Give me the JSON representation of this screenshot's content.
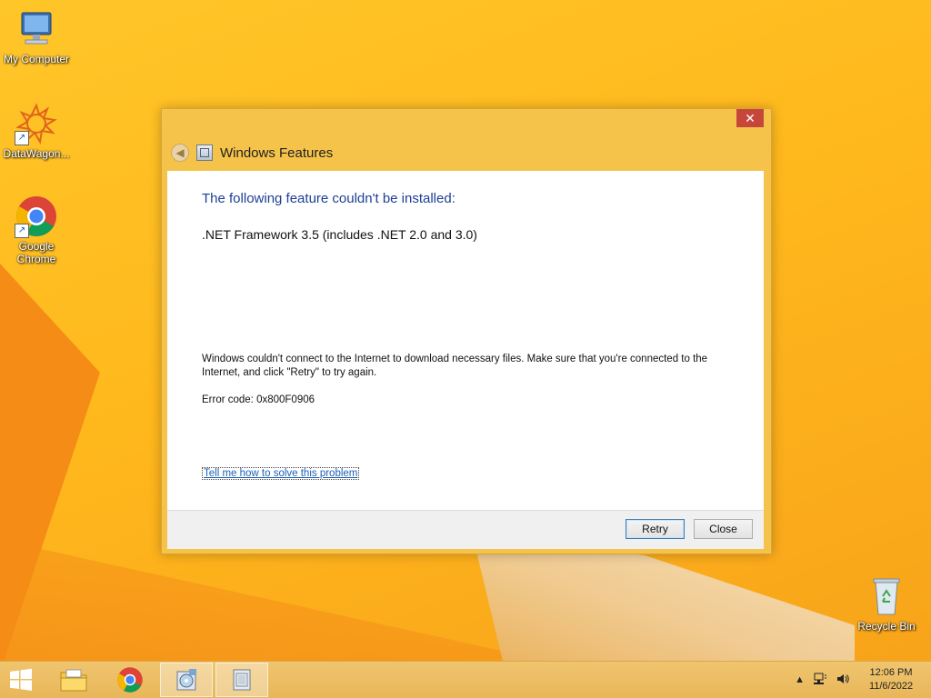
{
  "desktop": {
    "icons": [
      {
        "label": "My Computer"
      },
      {
        "label": "DataWagon..."
      },
      {
        "label": "Google Chrome"
      },
      {
        "label": "Recycle Bin"
      }
    ]
  },
  "dialog": {
    "title": "Windows Features",
    "close_glyph": "✕",
    "back_glyph": "◀",
    "heading": "The following feature couldn't be installed:",
    "feature": ".NET Framework 3.5 (includes .NET 2.0 and 3.0)",
    "message": "Windows couldn't connect to the Internet to download necessary files. Make sure that you're connected to the Internet, and click \"Retry\" to try again.",
    "error_code": "Error code: 0x800F0906",
    "help_link": "Tell me how to solve this problem",
    "buttons": {
      "retry": "Retry",
      "close": "Close"
    }
  },
  "taskbar": {
    "tray_arrow": "▲",
    "clock_time": "12:06 PM",
    "clock_date": "11/6/2022"
  },
  "colors": {
    "accent_heading": "#1c3f95",
    "link": "#1a5fb4",
    "close_red": "#c7463a"
  }
}
